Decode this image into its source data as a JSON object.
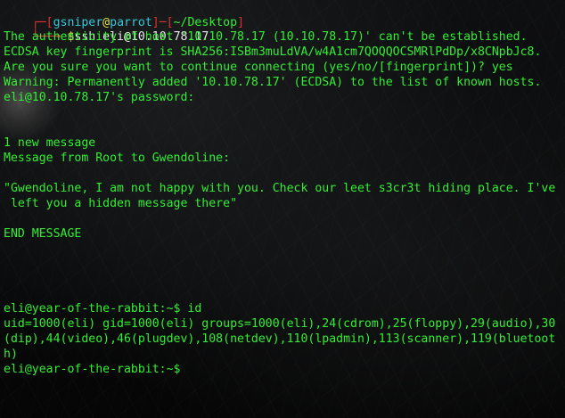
{
  "prompt": {
    "bracket_open_1": "┌─[",
    "user": "gsniper",
    "at": "@",
    "host": "parrot",
    "bracket_mid": "]─[",
    "cwd": "~/Desktop",
    "bracket_close": "]",
    "arrow": "└──╼ ",
    "dollar": "$",
    "command": "ssh eli@10.10.78.17"
  },
  "output": [
    "The authenticity of host '10.10.78.17 (10.10.78.17)' can't be established.",
    "ECDSA key fingerprint is SHA256:ISBm3muLdVA/w4A1cm7QOQQOCSMRlPdDp/x8CNpbJc8.",
    "Are you sure you want to continue connecting (yes/no/[fingerprint])? yes",
    "Warning: Permanently added '10.10.78.17' (ECDSA) to the list of known hosts.",
    "eli@10.10.78.17's password:",
    "",
    "",
    "1 new message",
    "Message from Root to Gwendoline:",
    "",
    "\"Gwendoline, I am not happy with you. Check our leet s3cr3t hiding place. I've",
    " left you a hidden message there\"",
    "",
    "END MESSAGE",
    "",
    "",
    "",
    "",
    "",
    "eli@year-of-the-rabbit:~$ id",
    "uid=1000(eli) gid=1000(eli) groups=1000(eli),24(cdrom),25(floppy),29(audio),30",
    "(dip),44(video),46(plugdev),108(netdev),110(lpadmin),113(scanner),119(bluetoot",
    "h)",
    "eli@year-of-the-rabbit:~$"
  ],
  "colors": {
    "output_text": "#33ee33",
    "prompt_frame": "#e03030",
    "prompt_user": "#39c6d8",
    "prompt_host": "#39c6d8",
    "prompt_dollar": "#e8e04a",
    "command_text": "#e8e8e8",
    "background": "#0a0b0c"
  }
}
